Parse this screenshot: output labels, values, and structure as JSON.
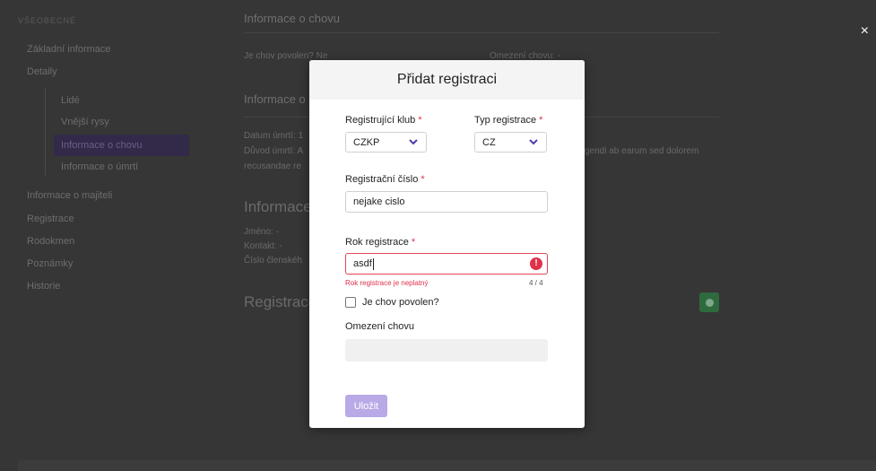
{
  "close_label": "×",
  "sidebar": {
    "section": "VŠEOBECNÉ",
    "items": [
      {
        "label": "Základní informace"
      },
      {
        "label": "Detaily"
      },
      {
        "label": "Informace o majiteli"
      },
      {
        "label": "Registrace"
      },
      {
        "label": "Rodokmen"
      },
      {
        "label": "Poznámky"
      },
      {
        "label": "Historie"
      }
    ],
    "sub_items": [
      {
        "label": "Lidé"
      },
      {
        "label": "Vnější rysy"
      },
      {
        "label": "Informace o chovu"
      },
      {
        "label": "Informace o úmrtí"
      }
    ]
  },
  "main": {
    "chov_heading": "Informace o chovu",
    "chov_allowed": "Je chov povolen? Ne",
    "chov_limit": "Omezení chovu: -",
    "umrti_heading": "Informace o",
    "death_date": "Datum úmrtí: 1",
    "death_reason": "Důvod úmrtí: A",
    "death_reason_tail": "gendi ab earum sed dolorem",
    "death_reason_line2": "recusandae re",
    "owner_heading": "Informace",
    "owner_name": "Jméno: -",
    "owner_contact": "Kontakt: -",
    "owner_member": "Číslo členskéh",
    "reg_heading": "Registrace"
  },
  "modal": {
    "title": "Přidat registraci",
    "club_label": "Registrující klub",
    "club_value": "CZKP",
    "type_label": "Typ registrace",
    "type_value": "CZ",
    "regnum_label": "Registrační číslo",
    "regnum_value": "nejake cislo",
    "year_label": "Rok registrace",
    "year_value": "asdf",
    "year_error": "Rok registrace je neplatný",
    "year_counter": "4 / 4",
    "breeding_allowed_label": "Je chov povolen?",
    "breeding_allowed_checked": false,
    "breeding_limit_label": "Omezení chovu",
    "breeding_limit_value": "",
    "save_label": "Uložit",
    "required_mark": "*",
    "error_icon": "!"
  },
  "colors": {
    "accent": "#b9a9e6",
    "error": "#e0314b",
    "active_sidebar": "#332a4a"
  }
}
